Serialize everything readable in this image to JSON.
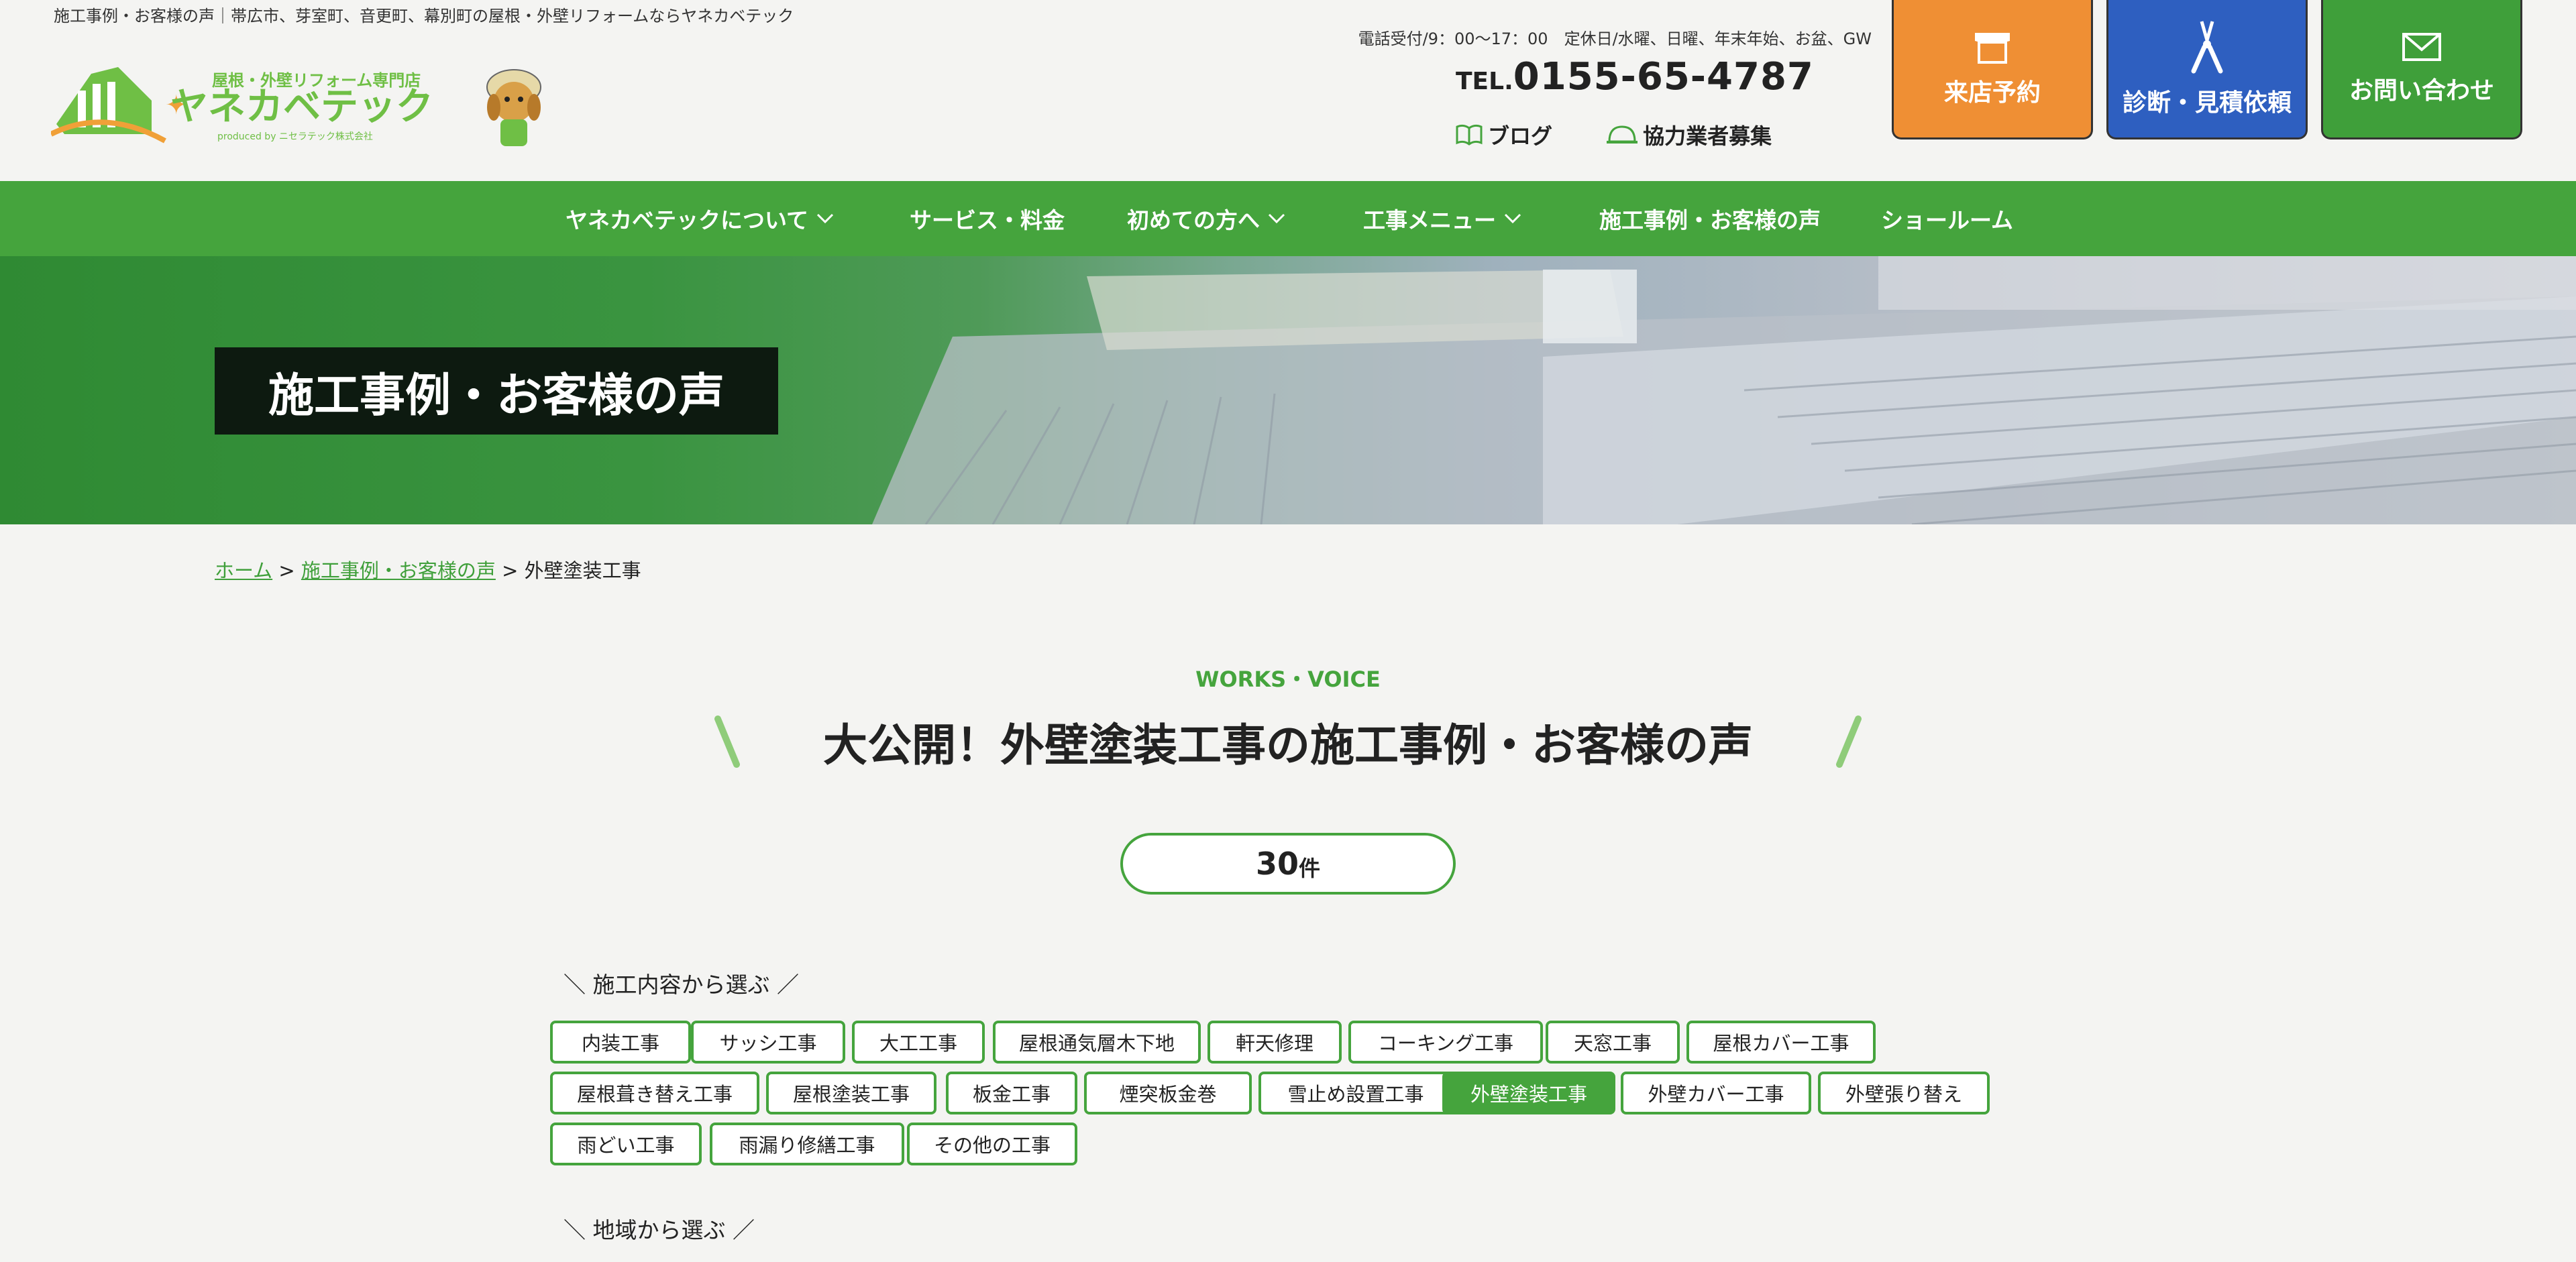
{
  "header": {
    "tagline": "施工事例・お客様の声｜帯広市、芽室町、音更町、幕別町の屋根・外壁リフォームならヤネカベテック",
    "logo": {
      "sub": "屋根・外壁リフォーム専門店",
      "name": "ヤネカベテック",
      "produced": "produced by ニセラテック株式会社"
    },
    "hours": "電話受付/9：00〜17：00　定休日/水曜、日曜、年末年始、お盆、GW",
    "tel_prefix": "TEL.",
    "tel_number": "0155-65-4787",
    "blog": "ブログ",
    "partner": "協力業者募集",
    "cta": {
      "visit": "来店予約",
      "diagnosis": "診断・見積依頼",
      "inquiry": "お問い合わせ"
    }
  },
  "nav": [
    {
      "label": "ヤネカベテックについて",
      "dropdown": true
    },
    {
      "label": "サービス・料金",
      "dropdown": false
    },
    {
      "label": "初めての方へ",
      "dropdown": true
    },
    {
      "label": "工事メニュー",
      "dropdown": true
    },
    {
      "label": "施工事例・お客様の声",
      "dropdown": false
    },
    {
      "label": "ショールーム",
      "dropdown": false
    }
  ],
  "hero": {
    "title": "施工事例・お客様の声"
  },
  "breadcrumb": {
    "home": "ホーム",
    "parent": "施工事例・お客様の声",
    "current": "外壁塗装工事",
    "sep": ">"
  },
  "section": {
    "eyebrow": "WORKS・VOICE",
    "heading": "大公開！外壁塗装工事の施工事例・お客様の声",
    "count": "30",
    "count_unit": "件"
  },
  "filters": {
    "by_work_label": "施工内容から選ぶ",
    "by_area_label": "地域から選ぶ",
    "active": "外壁塗装工事",
    "tags": [
      "内装工事",
      "サッシ工事",
      "大工工事",
      "屋根通気層木下地",
      "軒天修理",
      "コーキング工事",
      "天窓工事",
      "屋根カバー工事",
      "屋根葺き替え工事",
      "屋根塗装工事",
      "板金工事",
      "煙突板金巻",
      "雪止め設置工事",
      "外壁塗装工事",
      "外壁カバー工事",
      "外壁張り替え",
      "雨どい工事",
      "雨漏り修繕工事",
      "その他の工事"
    ]
  },
  "colors": {
    "brand_green": "#45a43d",
    "orange": "#ef8f34",
    "blue": "#2e5fc0",
    "hero_title_bg": "#0d1a10"
  }
}
